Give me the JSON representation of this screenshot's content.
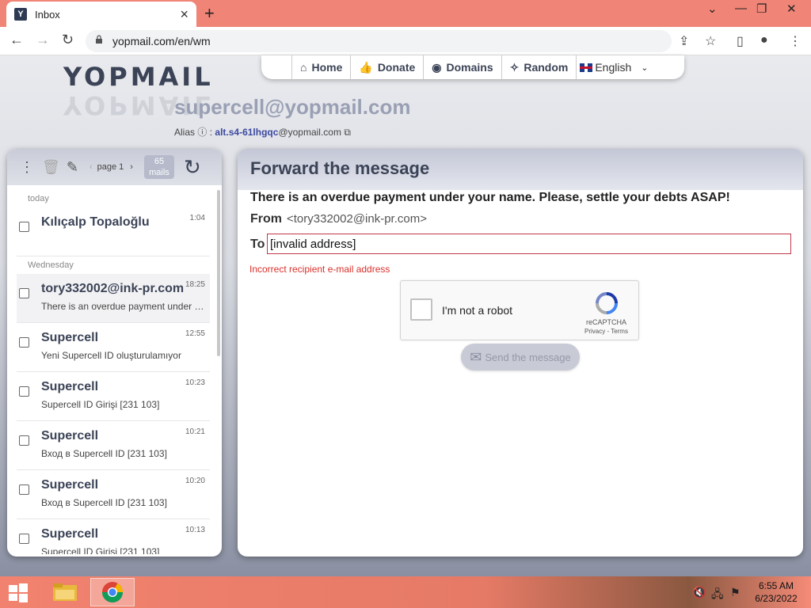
{
  "browser": {
    "tab_title": "Inbox",
    "url": "yopmail.com/en/wm"
  },
  "site": {
    "logo": "YOPMAIL",
    "nav": [
      {
        "label": "Home",
        "icon": "home-icon"
      },
      {
        "label": "Donate",
        "icon": "thumbs-up-icon"
      },
      {
        "label": "Domains",
        "icon": "globe-icon"
      },
      {
        "label": "Random",
        "icon": "magic-wand-icon"
      }
    ],
    "language": "English",
    "email_address": "supercell@yopmail.com",
    "alias_label": "Alias",
    "alias_sep": ":",
    "alias_value": "alt.s4-61lhgqc",
    "alias_domain": "@yopmail.com"
  },
  "inbox": {
    "page_label": "page 1",
    "mail_count": "65",
    "mail_count_unit": "mails",
    "groups": [
      {
        "day": "today",
        "items": [
          {
            "sender": "Kılıçalp Topaloğlu",
            "time": "1:04",
            "subject": ""
          }
        ]
      },
      {
        "day": "Wednesday",
        "items": [
          {
            "sender": "tory332002@ink-pr.com",
            "time": "18:25",
            "subject": "There is an overdue payment under your name. Please, settle your debts ASAP!",
            "selected": true
          },
          {
            "sender": "Supercell",
            "time": "12:55",
            "subject": "Yeni Supercell ID oluşturulamıyor"
          },
          {
            "sender": "Supercell",
            "time": "10:23",
            "subject": "Supercell ID Girişi [231 103]"
          },
          {
            "sender": "Supercell",
            "time": "10:21",
            "subject": "Вход в Supercell ID [231 103]"
          },
          {
            "sender": "Supercell",
            "time": "10:20",
            "subject": "Вход в Supercell ID [231 103]"
          },
          {
            "sender": "Supercell",
            "time": "10:13",
            "subject": "Supercell ID Girişi [231 103]"
          }
        ]
      }
    ]
  },
  "forward": {
    "title": "Forward the message",
    "subject": "There is an overdue payment under your name. Please, settle your debts ASAP!",
    "from_label": "From",
    "from_value": "<tory332002@ink-pr.com>",
    "to_label": "To",
    "to_value": "[invalid address]",
    "error": "Incorrect recipient e-mail address",
    "captcha_label": "I'm not a robot",
    "captcha_brand": "reCAPTCHA",
    "captcha_links": "Privacy - Terms",
    "send_label": "Send the message"
  },
  "taskbar": {
    "time": "6:55 AM",
    "date": "6/23/2022"
  }
}
